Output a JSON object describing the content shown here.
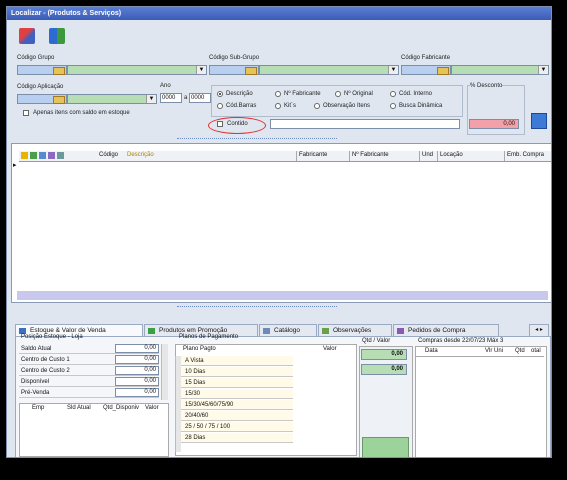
{
  "window": {
    "title": "Localizar - (Produtos & Serviços)"
  },
  "fields": {
    "codigo_grupo": "Código Grupo",
    "codigo_sub_grupo": "Código Sub-Grupo",
    "codigo_fabricante": "Código Fabricante",
    "codigo_aplicacao": "Código Aplicação",
    "ano": "Ano",
    "ano_from": "0000",
    "ano_sep": "a",
    "ano_to": "0000",
    "apenas_label": "Apenas itens com saldo em estoque",
    "desconto_label": "% Desconto",
    "desconto_value": "0,00"
  },
  "radios": {
    "descricao": "Descrição",
    "n_fabricante": "Nº Fabricante",
    "n_original": "Nº Original",
    "cod_interno": "Cód. Interno",
    "cod_barras": "Cód.Barras",
    "kits": "Kit´s",
    "observacao_itens": "Observação Itens",
    "busca_dinamica": "Busca Dinâmica"
  },
  "contido_label": "Contido",
  "grid": {
    "columns": [
      "Código",
      "Descrição",
      "Fabricante",
      "Nº Fabricante",
      "Und",
      "Locação",
      "Emb. Compra"
    ]
  },
  "tabs": [
    {
      "label": "Estoque & Valor de Venda"
    },
    {
      "label": "Produtos em Promoção"
    },
    {
      "label": "Catálogo"
    },
    {
      "label": "Observações"
    },
    {
      "label": "Pedidos de Compra"
    }
  ],
  "posicao": {
    "title": "Posição Estoque - Loja",
    "rows": [
      {
        "label": "Saldo Atual",
        "value": "0,00"
      },
      {
        "label": "Centro de Custo 1",
        "value": "0,00"
      },
      {
        "label": "Centro de Custo 2",
        "value": "0,00"
      },
      {
        "label": "Disponível",
        "value": "0,00"
      },
      {
        "label": "Pré-Venda",
        "value": "0,00"
      }
    ],
    "sub_columns": [
      "Emp",
      "Sld Atual",
      "Qtd_Disponiv",
      "Valor"
    ]
  },
  "planos": {
    "title": "Planos de Pagamento",
    "col_plano": "Plano Pagto",
    "col_valor": "Valor",
    "rows": [
      "A Vista",
      "10 Dias",
      "15 Dias",
      "15/30",
      "15/30/45/60/75/90",
      "20/40/60",
      "25 / 50 / 75 / 100",
      "28 Dias"
    ]
  },
  "qtd": {
    "title": "Qtd / Valor",
    "value1": "0,00",
    "value2": "0,00"
  },
  "compras": {
    "title": "Compras desde 22/07/23 Máx 3",
    "columns": [
      "Data",
      "Vlr Uni",
      "Qtd",
      "otal"
    ]
  }
}
